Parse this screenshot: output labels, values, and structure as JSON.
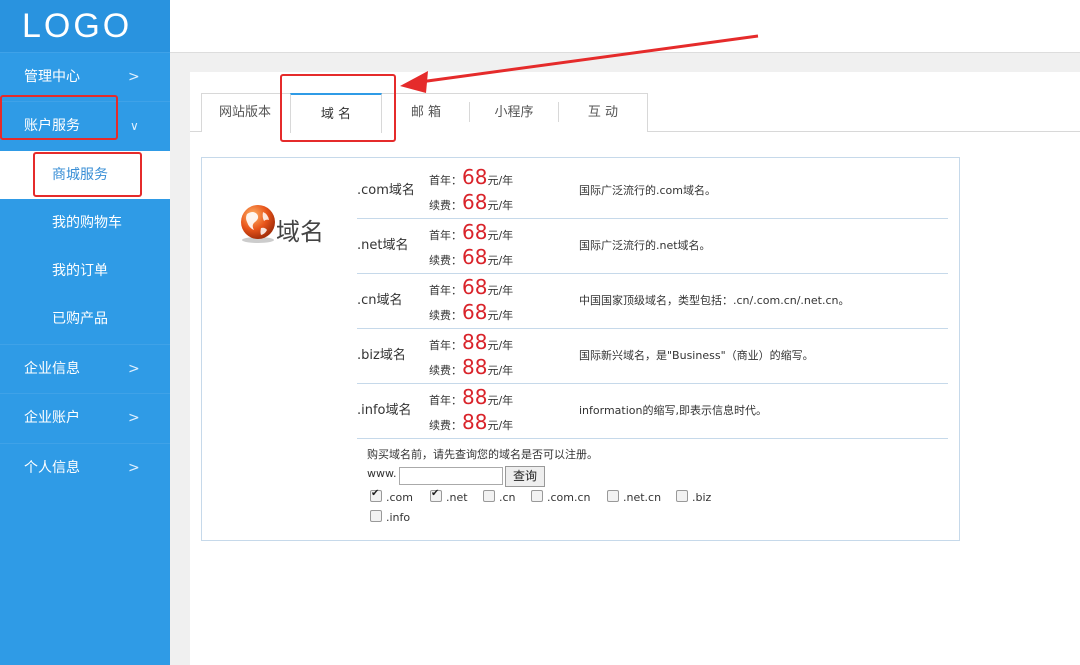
{
  "logo": "LOGO",
  "sidebar": {
    "items": [
      {
        "label": "管理中心",
        "chevron": ">"
      },
      {
        "label": "账户服务",
        "chevron": "∨"
      },
      {
        "label": "企业信息",
        "chevron": ">"
      },
      {
        "label": "企业账户",
        "chevron": ">"
      },
      {
        "label": "个人信息",
        "chevron": ">"
      }
    ],
    "sub_items": [
      "商城服务",
      "我的购物车",
      "我的订单",
      "已购产品"
    ]
  },
  "tabs": [
    "网站版本",
    "域 名",
    "邮 箱",
    "小程序",
    "互 动"
  ],
  "domain_logo_text": "域名",
  "price_labels": {
    "first": "首年：",
    "renew": "续费：",
    "unit": "元/年"
  },
  "domains": [
    {
      "name": ".com域名",
      "first": "68",
      "renew": "68",
      "desc": "国际广泛流行的.com域名。"
    },
    {
      "name": ".net域名",
      "first": "68",
      "renew": "68",
      "desc": "国际广泛流行的.net域名。"
    },
    {
      "name": ".cn域名",
      "first": "68",
      "renew": "68",
      "desc": "中国国家顶级域名，类型包括：.cn/.com.cn/.net.cn。"
    },
    {
      "name": ".biz域名",
      "first": "88",
      "renew": "88",
      "desc": "国际新兴域名，是\"Business\"（商业）的缩写。"
    },
    {
      "name": ".info域名",
      "first": "88",
      "renew": "88",
      "desc": "information的缩写,即表示信息时代。"
    }
  ],
  "search": {
    "hint": "购买域名前，请先查询您的域名是否可以注册。",
    "prefix": "www.",
    "button": "查询",
    "options": [
      {
        "label": ".com",
        "checked": true
      },
      {
        "label": ".net",
        "checked": true
      },
      {
        "label": ".cn",
        "checked": false
      },
      {
        "label": ".com.cn",
        "checked": false
      },
      {
        "label": ".net.cn",
        "checked": false
      },
      {
        "label": ".biz",
        "checked": false
      },
      {
        "label": ".info",
        "checked": false
      }
    ]
  },
  "colors": {
    "sidebar": "#2f9be6",
    "price": "#d9232a",
    "highlight": "#e52b2b"
  }
}
